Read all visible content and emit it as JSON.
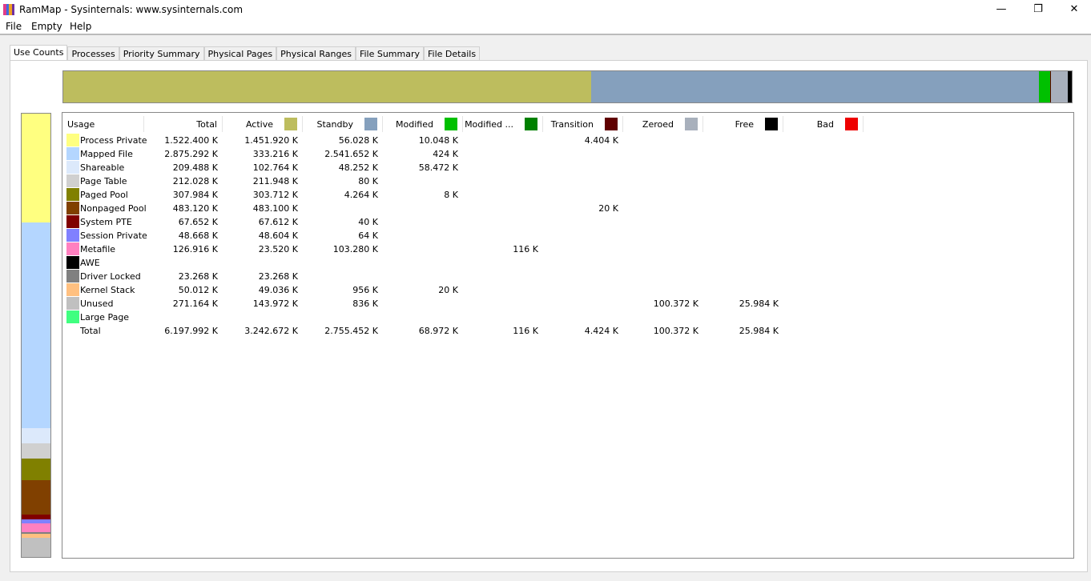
{
  "window": {
    "title": "RamMap - Sysinternals: www.sysinternals.com",
    "minimize": "—",
    "restore": "❐",
    "close": "✕"
  },
  "menu": [
    "File",
    "Empty",
    "Help"
  ],
  "tabs": [
    "Use Counts",
    "Processes",
    "Priority Summary",
    "Physical Pages",
    "Physical Ranges",
    "File Summary",
    "File Details"
  ],
  "columns": [
    {
      "label": "Usage"
    },
    {
      "label": "Total"
    },
    {
      "label": "Active",
      "color": "#bdbd5e"
    },
    {
      "label": "Standby",
      "color": "#85a0bd"
    },
    {
      "label": "Modified",
      "color": "#00c000"
    },
    {
      "label": "Modified ...",
      "color": "#008000"
    },
    {
      "label": "Transition",
      "color": "#600000"
    },
    {
      "label": "Zeroed",
      "color": "#a8b0bc"
    },
    {
      "label": "Free",
      "color": "#000000"
    },
    {
      "label": "Bad",
      "color": "#ee0000"
    }
  ],
  "state_totals_k": [
    3242672,
    2755452,
    68972,
    116,
    4424,
    100372,
    25984,
    0
  ],
  "rows": [
    {
      "label": "Process Private",
      "color": "#ffff80",
      "total_k": 1522400,
      "cells": [
        "1.522.400 K",
        "1.451.920 K",
        "56.028 K",
        "10.048 K",
        "",
        "4.404 K",
        "",
        "",
        ""
      ]
    },
    {
      "label": "Mapped File",
      "color": "#b4d6ff",
      "total_k": 2875292,
      "cells": [
        "2.875.292 K",
        "333.216 K",
        "2.541.652 K",
        "424 K",
        "",
        "",
        "",
        "",
        ""
      ]
    },
    {
      "label": "Shareable",
      "color": "#dce9fb",
      "total_k": 209488,
      "cells": [
        "209.488 K",
        "102.764 K",
        "48.252 K",
        "58.472 K",
        "",
        "",
        "",
        "",
        ""
      ]
    },
    {
      "label": "Page Table",
      "color": "#d0d0d0",
      "total_k": 212028,
      "cells": [
        "212.028 K",
        "211.948 K",
        "80 K",
        "",
        "",
        "",
        "",
        "",
        ""
      ]
    },
    {
      "label": "Paged Pool",
      "color": "#808000",
      "total_k": 307984,
      "cells": [
        "307.984 K",
        "303.712 K",
        "4.264 K",
        "8 K",
        "",
        "",
        "",
        "",
        ""
      ]
    },
    {
      "label": "Nonpaged Pool",
      "color": "#804000",
      "total_k": 483120,
      "cells": [
        "483.120 K",
        "483.100 K",
        "",
        "",
        "",
        "20 K",
        "",
        "",
        ""
      ]
    },
    {
      "label": "System PTE",
      "color": "#800000",
      "total_k": 67652,
      "cells": [
        "67.652 K",
        "67.612 K",
        "40 K",
        "",
        "",
        "",
        "",
        "",
        ""
      ]
    },
    {
      "label": "Session Private",
      "color": "#8080ff",
      "total_k": 48668,
      "cells": [
        "48.668 K",
        "48.604 K",
        "64 K",
        "",
        "",
        "",
        "",
        "",
        ""
      ]
    },
    {
      "label": "Metafile",
      "color": "#ff80c0",
      "total_k": 126916,
      "cells": [
        "126.916 K",
        "23.520 K",
        "103.280 K",
        "",
        "116 K",
        "",
        "",
        "",
        ""
      ]
    },
    {
      "label": "AWE",
      "color": "#000000",
      "total_k": 0,
      "cells": [
        "",
        "",
        "",
        "",
        "",
        "",
        "",
        "",
        ""
      ]
    },
    {
      "label": "Driver Locked",
      "color": "#808080",
      "total_k": 23268,
      "cells": [
        "23.268 K",
        "23.268 K",
        "",
        "",
        "",
        "",
        "",
        "",
        ""
      ]
    },
    {
      "label": "Kernel Stack",
      "color": "#ffc080",
      "total_k": 50012,
      "cells": [
        "50.012 K",
        "49.036 K",
        "956 K",
        "20 K",
        "",
        "",
        "",
        "",
        ""
      ]
    },
    {
      "label": "Unused",
      "color": "#c0c0c0",
      "total_k": 271164,
      "cells": [
        "271.164 K",
        "143.972 K",
        "836 K",
        "",
        "",
        "",
        "100.372 K",
        "25.984 K",
        ""
      ]
    },
    {
      "label": "Large Page",
      "color": "#40ff80",
      "total_k": 0,
      "cells": [
        "",
        "",
        "",
        "",
        "",
        "",
        "",
        "",
        ""
      ]
    },
    {
      "label": "Total",
      "cells": [
        "6.197.992 K",
        "3.242.672 K",
        "2.755.452 K",
        "68.972 K",
        "116 K",
        "4.424 K",
        "100.372 K",
        "25.984 K",
        ""
      ]
    }
  ]
}
